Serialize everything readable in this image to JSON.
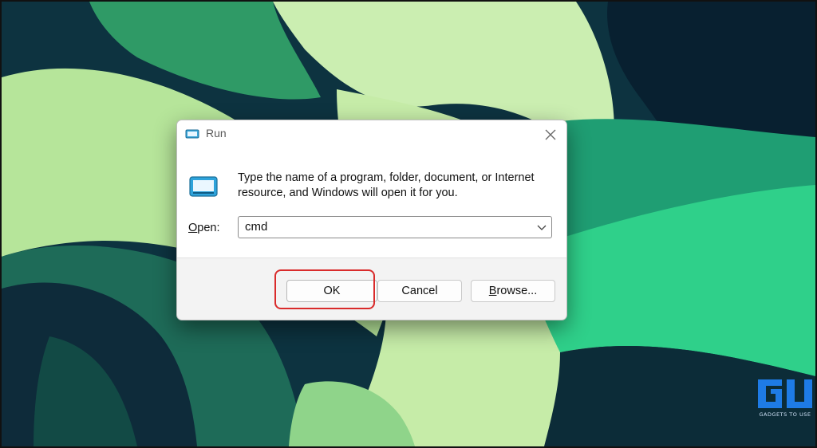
{
  "colors": {
    "highlight": "#d92b2b",
    "dialog_bg": "#f3f3f3",
    "watermark_blue": "#1e7be6"
  },
  "desktop": {
    "wallpaper": "green-abstract-ribbons"
  },
  "run_dialog": {
    "title": "Run",
    "title_icon": "run-icon",
    "close_icon": "close-icon",
    "app_icon": "run-icon",
    "description": "Type the name of a program, folder, document, or Internet resource, and Windows will open it for you.",
    "open_label_mnemonic": "O",
    "open_label_rest": "pen:",
    "open_value": "cmd",
    "dropdown_icon": "chevron-down-icon",
    "buttons": {
      "ok": "OK",
      "cancel": "Cancel",
      "browse_mnemonic": "B",
      "browse_rest": "rowse..."
    }
  },
  "annotation": {
    "target": "ok-button"
  },
  "watermark": {
    "logo": "gadgets-to-use-logo",
    "text": "GADGETS TO USE"
  }
}
